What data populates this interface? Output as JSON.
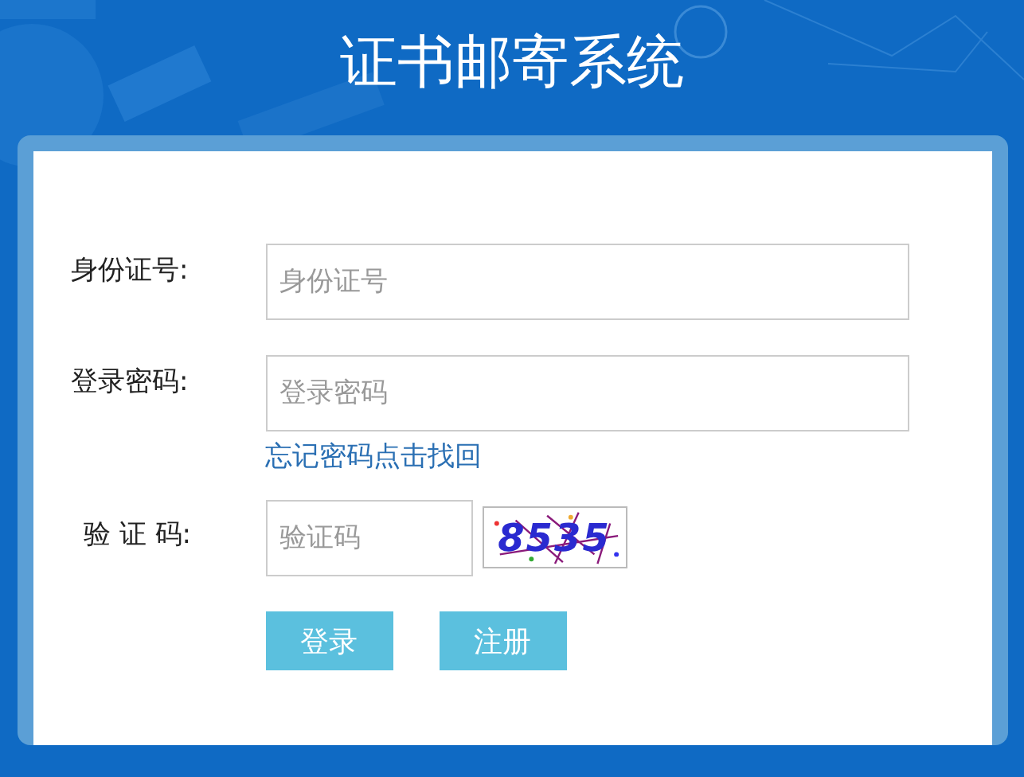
{
  "title": "证书邮寄系统",
  "fields": [
    {
      "label": "身份证号:",
      "placeholder": "身份证号"
    },
    {
      "label": "登录密码:",
      "placeholder": "登录密码"
    }
  ],
  "forgot_link": "忘记密码点击找回",
  "captcha": {
    "label": "验 证 码:",
    "placeholder": "验证码",
    "code": "8535"
  },
  "buttons": [
    "登录",
    "注册"
  ]
}
